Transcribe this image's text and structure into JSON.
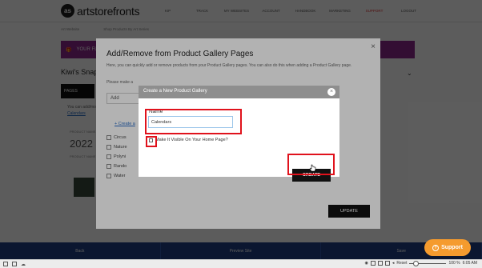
{
  "site": {
    "logo_text": "artstorefronts",
    "logo_mark": "as",
    "nav": [
      "Kip",
      "Track",
      "My Websites",
      "Account",
      "Handbook",
      "Marketing",
      "Support",
      "Logout"
    ],
    "breadcrumbs": [
      "Art Website",
      "Shop Products By Art Series"
    ],
    "promo_text": "YOUR FL",
    "shop_title": "Kiwi's Snap",
    "left_tab": "PAGES",
    "left_note_1": "You can add/move",
    "left_note_link": "Calendars",
    "product_label": "PRODUCT NAME",
    "product_year": "2022",
    "product_label_2": "PRODUCT NAME",
    "bottom_buttons": [
      "Back",
      "Preview Site",
      "Save"
    ],
    "support_label": "Support"
  },
  "modal": {
    "title": "Add/Remove from Product Gallery Pages",
    "description": "Here, you can quickly add or remove products from your Product Gallery pages. You can also do this when adding a Product Gallery page.",
    "make_note": "Please make a",
    "input_value": "Add",
    "create_link": "+ Create a",
    "gallery_items": [
      "Circus",
      "Nature",
      "Polyni",
      "Rando",
      "Water"
    ],
    "right_link": "...",
    "update_label": "UPDATE",
    "close_glyph": "×"
  },
  "dialog": {
    "title": "Create a New Product Gallery",
    "close_glyph": "×",
    "name_label": "Name",
    "name_value": "Calendars",
    "visible_label": "Make It Visible On Your Home Page?",
    "visible_checked": false,
    "create_label": "CREATE"
  },
  "taskbar": {
    "reset_label": "Reset",
    "zoom": "100 %",
    "time": "6:05 AM"
  },
  "colors": {
    "highlight": "#e0121c",
    "promo": "#8c2a8c",
    "bottom_bar": "#1f3f86",
    "support": "#f59b2e"
  }
}
